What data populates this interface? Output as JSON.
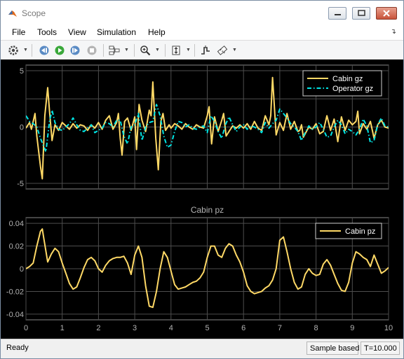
{
  "window": {
    "title": "Scope",
    "controls": [
      "minimize",
      "maximize",
      "close"
    ]
  },
  "menu": [
    "File",
    "Tools",
    "View",
    "Simulation",
    "Help"
  ],
  "toolbar": {
    "buttons": [
      "gear-icon",
      "step-back-icon",
      "run-icon",
      "step-forward-icon",
      "stop-icon",
      "signal-selector-icon",
      "zoom-in-icon",
      "autoscale-icon",
      "triggers-icon",
      "cursor-measurements-icon"
    ]
  },
  "theme": {
    "axes_bg": "#000000",
    "grid": "#4d4d4d",
    "tick_color": "#b3b3b3",
    "series_yellow": "#ffd966",
    "series_cyan": "#00e5e5"
  },
  "chart_data": [
    {
      "type": "line",
      "title": "",
      "xlim": [
        0,
        10
      ],
      "ylim": [
        -5.5,
        5.5
      ],
      "yticks": [
        -5,
        0,
        5
      ],
      "grid": true,
      "legend": "top-right",
      "series": [
        {
          "name": "Cabin gz",
          "color": "#ffd966",
          "style": "solid",
          "x": [
            0,
            0.1,
            0.15,
            0.25,
            0.3,
            0.4,
            0.45,
            0.52,
            0.6,
            0.65,
            0.72,
            0.8,
            0.9,
            1.0,
            1.1,
            1.2,
            1.3,
            1.4,
            1.5,
            1.6,
            1.7,
            1.8,
            1.9,
            2.0,
            2.1,
            2.2,
            2.3,
            2.4,
            2.5,
            2.55,
            2.6,
            2.65,
            2.72,
            2.8,
            2.9,
            3.0,
            3.05,
            3.12,
            3.2,
            3.3,
            3.4,
            3.45,
            3.5,
            3.58,
            3.65,
            3.72,
            3.78,
            3.85,
            3.95,
            4.0,
            4.1,
            4.2,
            4.3,
            4.4,
            4.5,
            4.6,
            4.7,
            4.8,
            4.9,
            5.0,
            5.05,
            5.12,
            5.2,
            5.3,
            5.4,
            5.45,
            5.52,
            5.6,
            5.7,
            5.8,
            5.9,
            6.0,
            6.1,
            6.2,
            6.3,
            6.4,
            6.5,
            6.6,
            6.7,
            6.75,
            6.8,
            6.9,
            7.0,
            7.1,
            7.2,
            7.3,
            7.4,
            7.5,
            7.55,
            7.6,
            7.65,
            7.7,
            7.8,
            7.9,
            8.0,
            8.1,
            8.2,
            8.3,
            8.4,
            8.5,
            8.6,
            8.7,
            8.8,
            8.9,
            9.0,
            9.1,
            9.15,
            9.2,
            9.3,
            9.4,
            9.5,
            9.6,
            9.7,
            9.8,
            9.9,
            10.0
          ],
          "y": [
            -0.1,
            0.4,
            -0.2,
            1.2,
            -0.8,
            -3.5,
            -4.6,
            1.0,
            3.5,
            1.4,
            -1.2,
            0.2,
            -0.3,
            0.4,
            0.1,
            -0.2,
            0.3,
            -0.1,
            0.2,
            0.1,
            -0.3,
            0.2,
            -0.1,
            0.4,
            -0.2,
            0.6,
            1.0,
            -0.2,
            0.4,
            1.2,
            -1.0,
            -2.5,
            0.5,
            0.8,
            -0.3,
            0.9,
            -2.0,
            2.0,
            0.6,
            -0.4,
            1.5,
            1.0,
            4.0,
            -1.0,
            -3.8,
            0.5,
            1.2,
            -0.3,
            0.2,
            -0.1,
            0.3,
            0.1,
            -0.2,
            0.3,
            0.0,
            -0.2,
            0.2,
            0.0,
            -0.1,
            1.0,
            1.8,
            -1.5,
            0.9,
            -0.4,
            0.6,
            1.2,
            -0.8,
            -0.4,
            0.1,
            -0.1,
            0.2,
            -0.1,
            0.3,
            -0.2,
            0.5,
            -0.1,
            -0.3,
            1.0,
            0.2,
            1.0,
            4.4,
            -0.7,
            0.4,
            -0.3,
            1.2,
            -0.2,
            0.5,
            -0.4,
            -0.3,
            0.2,
            -0.9,
            -0.6,
            0.0,
            -0.2,
            0.3,
            -0.6,
            -0.4,
            1.0,
            -0.3,
            0.7,
            -1.3,
            0.9,
            -0.3,
            0.6,
            0.2,
            0.5,
            1.4,
            -0.6,
            0.3,
            -0.2,
            0.5,
            -1.0,
            0.2,
            0.6,
            0.0,
            -0.1
          ]
        },
        {
          "name": "Operator gz",
          "color": "#00e5e5",
          "style": "dash-dot",
          "x": [
            0,
            0.1,
            0.2,
            0.3,
            0.4,
            0.5,
            0.55,
            0.65,
            0.72,
            0.8,
            0.9,
            1.0,
            1.1,
            1.2,
            1.3,
            1.4,
            1.5,
            1.6,
            1.7,
            1.8,
            1.9,
            2.0,
            2.1,
            2.2,
            2.3,
            2.4,
            2.5,
            2.6,
            2.7,
            2.8,
            2.9,
            3.0,
            3.1,
            3.2,
            3.3,
            3.4,
            3.5,
            3.6,
            3.7,
            3.8,
            3.9,
            4.0,
            4.1,
            4.2,
            4.3,
            4.4,
            4.5,
            4.6,
            4.7,
            4.8,
            4.9,
            5.0,
            5.1,
            5.2,
            5.3,
            5.4,
            5.5,
            5.6,
            5.7,
            5.8,
            5.9,
            6.0,
            6.1,
            6.2,
            6.3,
            6.4,
            6.5,
            6.6,
            6.7,
            6.8,
            6.9,
            7.0,
            7.1,
            7.2,
            7.3,
            7.4,
            7.5,
            7.6,
            7.7,
            7.8,
            7.9,
            8.0,
            8.1,
            8.2,
            8.3,
            8.4,
            8.5,
            8.6,
            8.7,
            8.8,
            8.9,
            9.0,
            9.1,
            9.2,
            9.3,
            9.4,
            9.5,
            9.6,
            9.7,
            9.8,
            9.9,
            10.0
          ],
          "y": [
            1.0,
            0.5,
            0.3,
            0.0,
            -1.0,
            -1.8,
            -2.2,
            0.5,
            1.5,
            0.4,
            -0.2,
            -0.3,
            0.0,
            0.3,
            0.8,
            0.2,
            -0.3,
            -0.4,
            -0.1,
            0.2,
            -0.5,
            -0.3,
            -0.1,
            0.4,
            0.3,
            0.0,
            0.6,
            0.6,
            -0.8,
            -1.5,
            0.0,
            0.2,
            1.2,
            -1.2,
            0.0,
            0.4,
            0.5,
            2.0,
            1.0,
            -0.8,
            -1.8,
            -1.6,
            -0.4,
            0.5,
            0.4,
            0.0,
            0.2,
            -0.1,
            -0.2,
            0.0,
            0.1,
            -0.5,
            1.0,
            0.5,
            -0.4,
            -1.0,
            0.2,
            0.9,
            0.2,
            -0.4,
            0.0,
            0.2,
            -0.2,
            0.1,
            0.0,
            -0.2,
            -0.5,
            0.4,
            -0.1,
            0.3,
            0.6,
            1.6,
            1.2,
            0.8,
            0.3,
            0.0,
            -0.4,
            -1.2,
            -0.5,
            0.1,
            -0.2,
            0.0,
            0.4,
            -0.2,
            -0.9,
            -0.8,
            0.0,
            0.6,
            0.2,
            -0.6,
            -0.2,
            -0.4,
            -0.7,
            -0.2,
            0.7,
            0.1,
            -1.4,
            -1.2,
            0.2,
            0.8,
            0.1,
            0.0
          ]
        }
      ]
    },
    {
      "type": "line",
      "title": "Cabin pz",
      "xlim": [
        0,
        10
      ],
      "ylim": [
        -0.045,
        0.045
      ],
      "xticks": [
        0,
        1,
        2,
        3,
        4,
        5,
        6,
        7,
        8,
        9,
        10
      ],
      "yticks": [
        -0.04,
        -0.02,
        0,
        0.02,
        0.04
      ],
      "grid": true,
      "legend": "top-right",
      "series": [
        {
          "name": "Cabin pz",
          "color": "#ffd966",
          "style": "solid",
          "x": [
            0,
            0.1,
            0.2,
            0.3,
            0.4,
            0.45,
            0.5,
            0.6,
            0.7,
            0.8,
            0.9,
            1.0,
            1.1,
            1.2,
            1.3,
            1.4,
            1.5,
            1.6,
            1.7,
            1.8,
            1.9,
            2.0,
            2.1,
            2.2,
            2.3,
            2.4,
            2.5,
            2.6,
            2.7,
            2.8,
            2.9,
            3.0,
            3.1,
            3.2,
            3.3,
            3.4,
            3.5,
            3.6,
            3.7,
            3.8,
            3.9,
            4.0,
            4.1,
            4.2,
            4.3,
            4.4,
            4.5,
            4.6,
            4.7,
            4.8,
            4.9,
            5.0,
            5.1,
            5.2,
            5.3,
            5.4,
            5.5,
            5.6,
            5.7,
            5.8,
            5.9,
            6.0,
            6.1,
            6.2,
            6.3,
            6.4,
            6.5,
            6.6,
            6.7,
            6.8,
            6.9,
            7.0,
            7.1,
            7.2,
            7.3,
            7.4,
            7.5,
            7.6,
            7.7,
            7.8,
            7.9,
            8.0,
            8.1,
            8.2,
            8.3,
            8.4,
            8.5,
            8.6,
            8.7,
            8.8,
            8.9,
            9.0,
            9.1,
            9.2,
            9.3,
            9.4,
            9.5,
            9.6,
            9.7,
            9.8,
            9.9,
            10.0
          ],
          "y": [
            0.0,
            0.002,
            0.005,
            0.02,
            0.033,
            0.035,
            0.025,
            0.006,
            0.013,
            0.018,
            0.015,
            0.005,
            -0.004,
            -0.013,
            -0.018,
            -0.016,
            -0.008,
            0.001,
            0.008,
            0.01,
            0.007,
            0.0,
            -0.003,
            0.003,
            0.007,
            0.009,
            0.01,
            0.01,
            0.011,
            0.005,
            -0.005,
            0.012,
            0.02,
            0.01,
            -0.015,
            -0.033,
            -0.034,
            -0.02,
            0.0,
            0.015,
            0.01,
            -0.002,
            -0.014,
            -0.018,
            -0.017,
            -0.016,
            -0.014,
            -0.012,
            -0.011,
            -0.008,
            -0.003,
            0.01,
            0.02,
            0.02,
            0.012,
            0.01,
            0.018,
            0.022,
            0.02,
            0.012,
            0.006,
            -0.003,
            -0.015,
            -0.02,
            -0.022,
            -0.021,
            -0.02,
            -0.017,
            -0.015,
            -0.01,
            0.0,
            0.025,
            0.028,
            0.015,
            0.0,
            -0.012,
            -0.018,
            -0.016,
            -0.005,
            0.0,
            -0.004,
            -0.006,
            -0.005,
            0.004,
            0.008,
            0.003,
            -0.005,
            -0.013,
            -0.019,
            -0.02,
            -0.012,
            0.005,
            0.015,
            0.013,
            0.01,
            0.008,
            0.002,
            0.012,
            0.004,
            -0.004,
            -0.002,
            0.001
          ]
        }
      ]
    }
  ]
}
